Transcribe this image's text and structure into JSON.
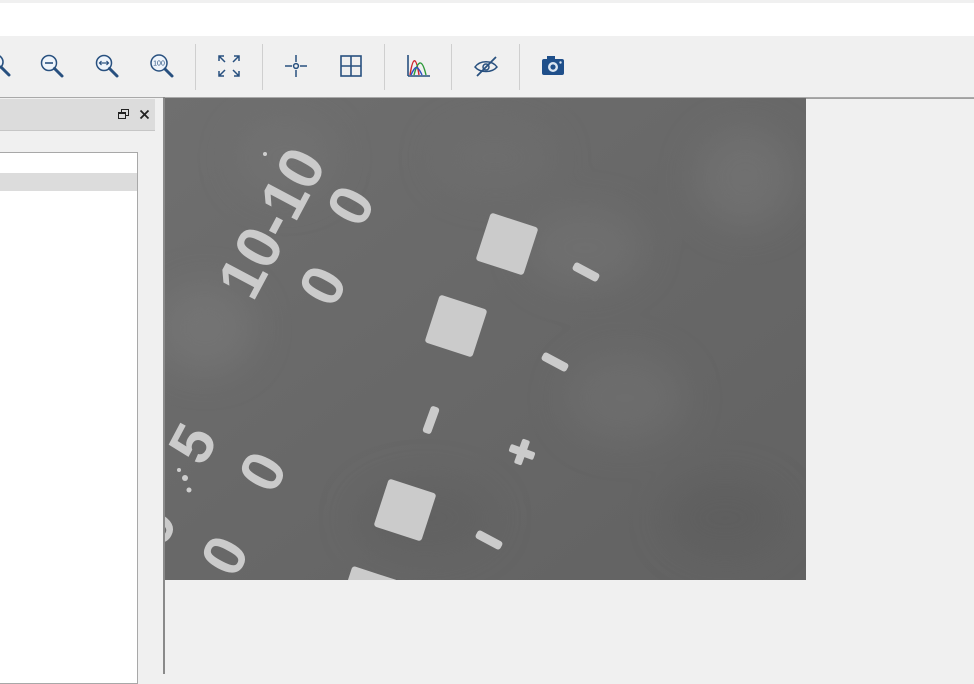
{
  "window": {
    "title_bar_text": ""
  },
  "toolbar": {
    "buttons": [
      {
        "id": "zoom-partial",
        "icon": "zoom-icon"
      },
      {
        "id": "zoom-out",
        "icon": "zoom-out-icon"
      },
      {
        "id": "zoom-fit-width",
        "icon": "zoom-fit-width-icon"
      },
      {
        "id": "zoom-100",
        "icon": "zoom-100-icon",
        "label": "100"
      },
      {
        "id": "fit-to-window",
        "icon": "expand-icon"
      },
      {
        "id": "crosshair",
        "icon": "crosshair-icon"
      },
      {
        "id": "grid",
        "icon": "grid-icon"
      },
      {
        "id": "histogram",
        "icon": "histogram-icon"
      },
      {
        "id": "hide-overlay",
        "icon": "eye-slash-icon"
      },
      {
        "id": "snapshot",
        "icon": "camera-icon"
      }
    ]
  },
  "dock": {
    "title": "",
    "restore_icon": "restore-icon",
    "close_icon": "close-icon",
    "list_items": [
      ""
    ]
  },
  "viewer": {
    "image": {
      "description_icon": "camera-image",
      "markings": [
        "10-10",
        "0",
        "0",
        "0",
        "0",
        "5",
        "0",
        "0",
        "-",
        "-",
        "-",
        "+",
        "-"
      ]
    }
  },
  "colors": {
    "accent": "#1f4f8a",
    "toolbar_bg": "#f0f0f0",
    "image_bg": "#6b6b6b",
    "marking": "#cbcbcb"
  }
}
